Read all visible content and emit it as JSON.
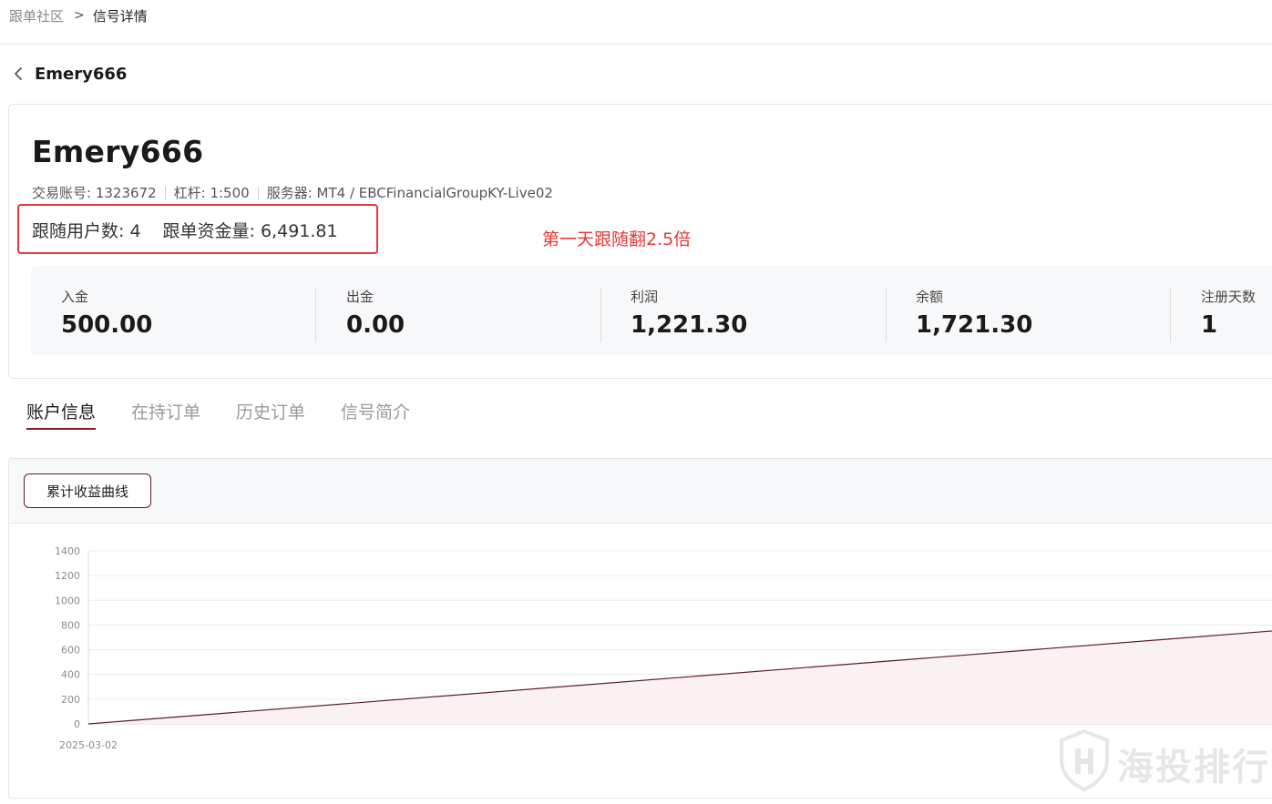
{
  "breadcrumb": {
    "parent": "跟单社区",
    "separator": ">",
    "current": "信号详情"
  },
  "header": {
    "title": "Emery666"
  },
  "signal": {
    "name": "Emery666",
    "account_label": "交易账号: 1323672",
    "leverage_label": "杠杆: 1:500",
    "server_label": "服务器: MT4 / EBCFinancialGroupKY-Live02",
    "followers_label": "跟随用户数: 4",
    "funds_label": "跟单资金量: 6,491.81",
    "annotation": "第一天跟随翻2.5倍",
    "annotation_color": "#e53935"
  },
  "stats": [
    {
      "label": "入金",
      "value": "500.00"
    },
    {
      "label": "出金",
      "value": "0.00"
    },
    {
      "label": "利润",
      "value": "1,221.30"
    },
    {
      "label": "余额",
      "value": "1,721.30"
    },
    {
      "label": "注册天数",
      "value": "1"
    }
  ],
  "tabs": [
    {
      "label": "账户信息",
      "active": true
    },
    {
      "label": "在持订单",
      "active": false
    },
    {
      "label": "历史订单",
      "active": false
    },
    {
      "label": "信号简介",
      "active": false
    }
  ],
  "chart_toolbar": {
    "button_label": "累计收益曲线"
  },
  "chart_data": {
    "type": "area",
    "title": "",
    "xlabel": "",
    "ylabel": "",
    "x": [
      "2025-03-02",
      ""
    ],
    "y_ticks": [
      0,
      200,
      400,
      600,
      800,
      1000,
      1200,
      1400
    ],
    "ylim": [
      0,
      1400
    ],
    "series": [
      {
        "values": [
          0,
          760
        ]
      }
    ],
    "grid": true,
    "line_color": "#5a1e28",
    "fill_color": "#fbf1f2"
  },
  "watermark": {
    "text": "海投排行"
  }
}
